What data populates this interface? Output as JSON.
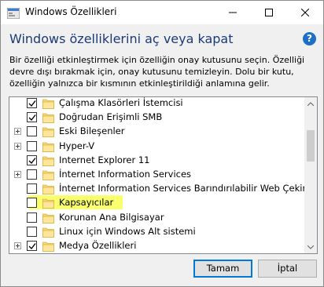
{
  "window": {
    "title": "Windows Özellikleri"
  },
  "header": {
    "title": "Windows özelliklerini aç veya kapat",
    "help": "?",
    "description": "Bir özelliği etkinleştirmek için özelliğin onay kutusunu seçin. Özelliği devre dışı bırakmak için, onay kutusunu temizleyin. Dolu bir kutu, özelliğin yalnızca bir kısmının etkinleştirildiği anlamına gelir."
  },
  "features": [
    {
      "label": "Çalışma Klasörleri İstemcisi",
      "checked": true,
      "expandable": false
    },
    {
      "label": "Doğrudan Erişimli SMB",
      "checked": true,
      "expandable": false
    },
    {
      "label": "Eski Bileşenler",
      "checked": false,
      "expandable": true
    },
    {
      "label": "Hyper-V",
      "checked": false,
      "expandable": true
    },
    {
      "label": "Internet Explorer 11",
      "checked": true,
      "expandable": false
    },
    {
      "label": "İnternet Information Services",
      "checked": false,
      "expandable": true
    },
    {
      "label": "İnternet Information Services Barındırılabilir Web Çekirdeği",
      "checked": false,
      "expandable": false
    },
    {
      "label": "Kapsayıcılar",
      "checked": false,
      "expandable": false,
      "highlighted": true
    },
    {
      "label": "Korunan Ana Bilgisayar",
      "checked": false,
      "expandable": false
    },
    {
      "label": "Linux için Windows Alt sistemi",
      "checked": false,
      "expandable": false
    },
    {
      "label": "Medya Özellikleri",
      "checked": true,
      "expandable": true
    }
  ],
  "buttons": {
    "ok": "Tamam",
    "cancel": "İptal"
  },
  "colors": {
    "header_title": "#1a3a78",
    "highlight": "#faff6e",
    "ok_border": "#0078d7",
    "folder": "#f8d775"
  },
  "icons": {
    "app": "windows-features-icon",
    "help": "help-icon",
    "folder": "folder-icon",
    "minimize": "minimize-icon",
    "maximize": "maximize-icon",
    "close": "close-icon"
  }
}
